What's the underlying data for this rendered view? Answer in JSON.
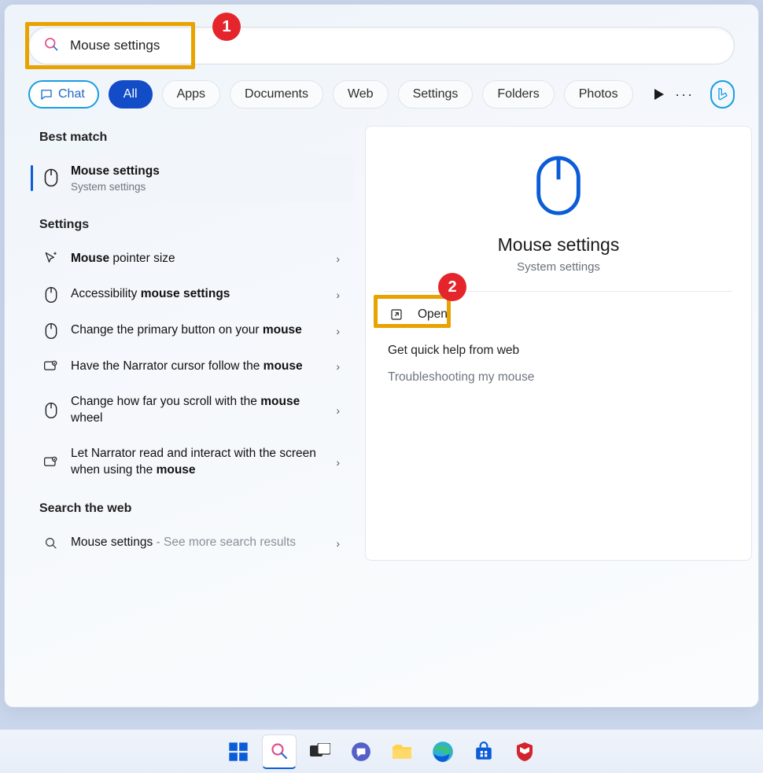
{
  "search": {
    "query": "Mouse settings"
  },
  "callouts": {
    "one": "1",
    "two": "2"
  },
  "tabs": {
    "chat": "Chat",
    "items": [
      "All",
      "Apps",
      "Documents",
      "Web",
      "Settings",
      "Folders",
      "Photos"
    ],
    "active": "All"
  },
  "left": {
    "best_match_header": "Best match",
    "best_match": {
      "title": "Mouse settings",
      "sub": "System settings"
    },
    "settings_header": "Settings",
    "settings_items": [
      {
        "icon": "pointer",
        "pre": "Mouse ",
        "bold": "",
        "post": "pointer size",
        "bold2": ""
      },
      {
        "icon": "mouse",
        "pre": "Accessibility ",
        "bold": "mouse settings",
        "post": "",
        "bold2": ""
      },
      {
        "icon": "mouse",
        "pre": "Change the primary button on your ",
        "bold": "mouse",
        "post": "",
        "bold2": ""
      },
      {
        "icon": "narrator",
        "pre": "Have the Narrator cursor follow the ",
        "bold": "mouse",
        "post": "",
        "bold2": ""
      },
      {
        "icon": "mouse",
        "pre": "Change how far you scroll with the ",
        "bold": "mouse",
        "post": " wheel",
        "bold2": ""
      },
      {
        "icon": "narrator",
        "pre": "Let Narrator read and interact with the screen when using the ",
        "bold": "mouse",
        "post": "",
        "bold2": ""
      }
    ],
    "web_header": "Search the web",
    "web_item": {
      "title": "Mouse settings",
      "suffix": " - See more search results"
    }
  },
  "right": {
    "title": "Mouse settings",
    "sub": "System settings",
    "open_label": "Open",
    "help_header": "Get quick help from web",
    "help_items": [
      "Troubleshooting my mouse"
    ]
  },
  "taskbar": {
    "items": [
      "start",
      "search",
      "taskview",
      "chat",
      "explorer",
      "edge",
      "store",
      "mcafee"
    ]
  }
}
